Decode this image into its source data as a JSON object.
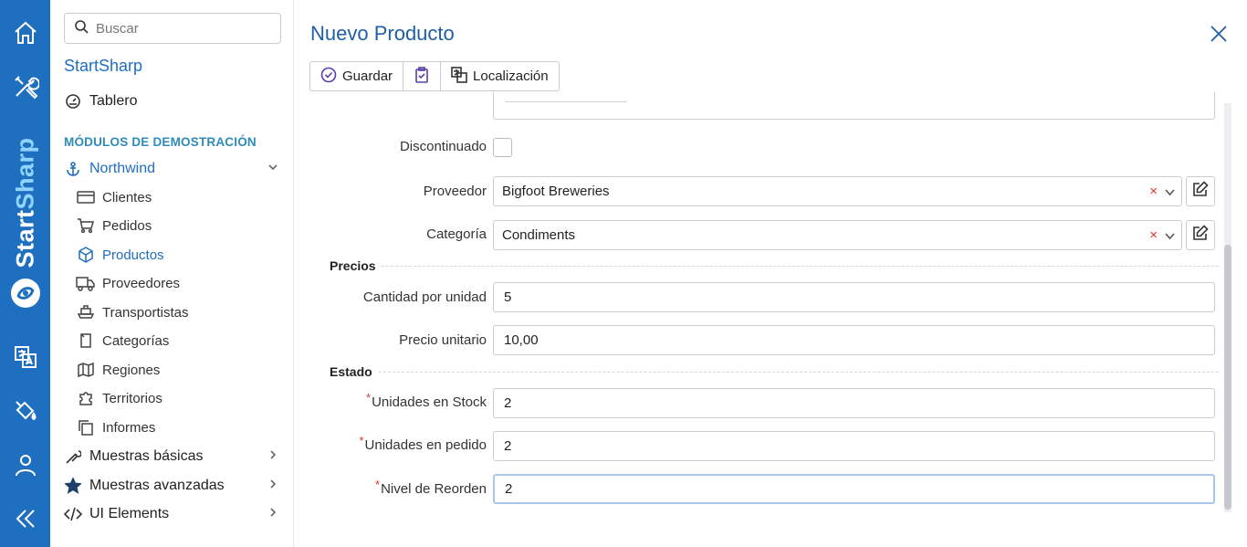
{
  "rail": {
    "brand_a": "Start",
    "brand_b": "Sharp"
  },
  "sidebar": {
    "search_placeholder": "Buscar",
    "title": "StartSharp",
    "dashboard": "Tablero",
    "section": "MÓDULOS DE DEMOSTRACIÓN",
    "northwind": "Northwind",
    "items": [
      {
        "label": "Clientes",
        "icon": "card-icon"
      },
      {
        "label": "Pedidos",
        "icon": "cart-icon"
      },
      {
        "label": "Productos",
        "icon": "cube-icon"
      },
      {
        "label": "Proveedores",
        "icon": "truck-icon"
      },
      {
        "label": "Transportistas",
        "icon": "ship-icon"
      },
      {
        "label": "Categorías",
        "icon": "folder-icon"
      },
      {
        "label": "Regiones",
        "icon": "map-icon"
      },
      {
        "label": "Territorios",
        "icon": "puzzle-icon"
      },
      {
        "label": "Informes",
        "icon": "copy-icon"
      }
    ],
    "basic_samples": "Muestras básicas",
    "advanced_samples": "Muestras avanzadas",
    "ui_elements": "UI Elements"
  },
  "dialog": {
    "title": "Nuevo Producto",
    "toolbar": {
      "save": "Guardar",
      "localization": "Localización"
    },
    "fields": {
      "discontinued_label": "Discontinuado",
      "supplier_label": "Proveedor",
      "supplier_value": "Bigfoot Breweries",
      "category_label": "Categoría",
      "category_value": "Condiments",
      "prices_head": "Precios",
      "qty_label": "Cantidad por unidad",
      "qty_value": "5",
      "price_label": "Precio unitario",
      "price_value": "10,00",
      "status_head": "Estado",
      "stock_label": "Unidades en Stock",
      "stock_value": "2",
      "order_label": "Unidades en pedido",
      "order_value": "2",
      "reorder_label": "Nivel de Reorden",
      "reorder_value": "2",
      "required_mark": "*",
      "clear_mark": "×"
    }
  },
  "colors": {
    "rail": "#1f6fc1",
    "accent": "#1f6fc1",
    "section": "#2f8bb8",
    "required": "#d9352e"
  }
}
